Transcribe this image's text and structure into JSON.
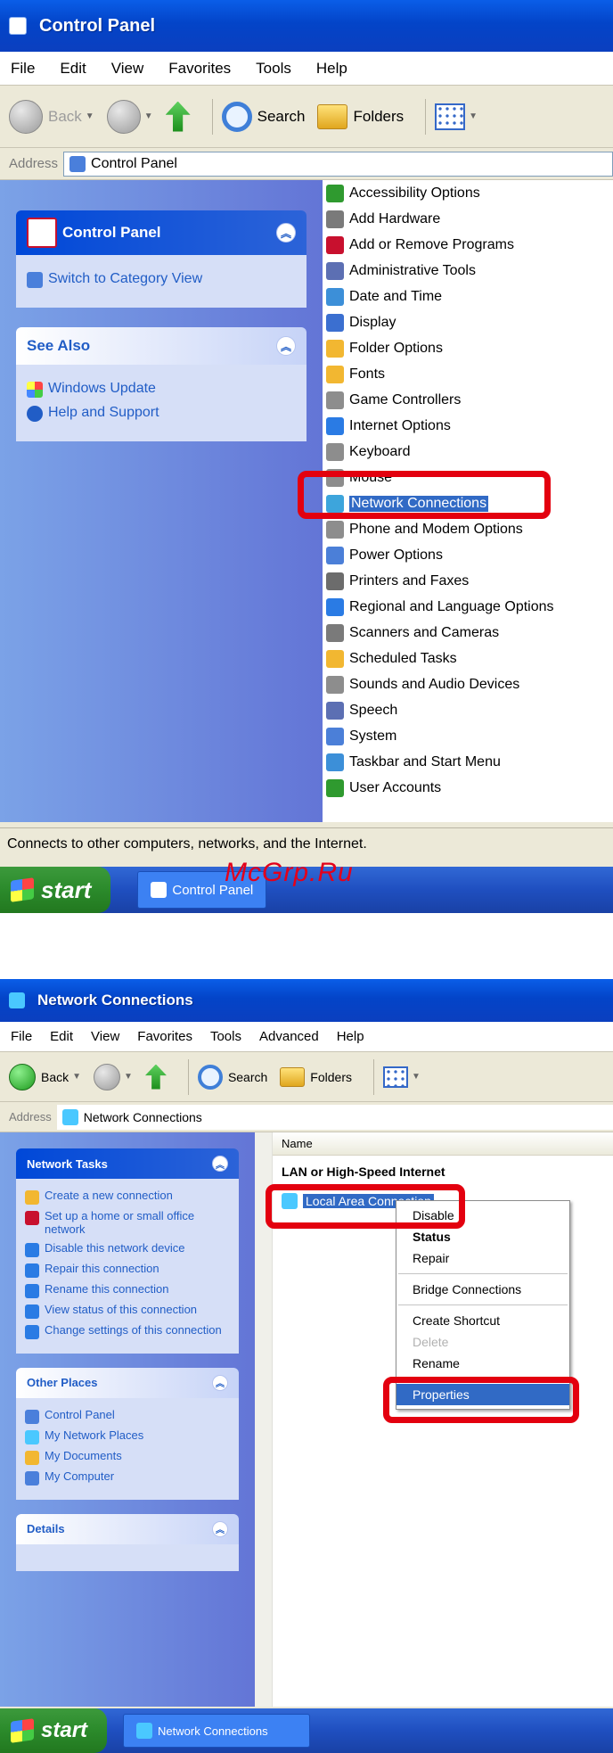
{
  "colors": {
    "highlight_box": "#e3000f",
    "xp_blue": "#0344c8",
    "selection": "#316ac5",
    "watermark": "#e3001b"
  },
  "screen1": {
    "title": "Control Panel",
    "menu": [
      "File",
      "Edit",
      "View",
      "Favorites",
      "Tools",
      "Help"
    ],
    "toolbar": {
      "back": "Back",
      "search": "Search",
      "folders": "Folders"
    },
    "address_label": "Address",
    "address_value": "Control Panel",
    "taskpane": {
      "control_panel_title": "Control Panel",
      "switch_link": "Switch to Category View",
      "see_also_title": "See Also",
      "see_also_links": [
        "Windows Update",
        "Help and Support"
      ]
    },
    "items": [
      "Accessibility Options",
      "Add Hardware",
      "Add or Remove Programs",
      "Administrative Tools",
      "Date and Time",
      "Display",
      "Folder Options",
      "Fonts",
      "Game Controllers",
      "Internet Options",
      "Keyboard",
      "Mouse",
      "Network Connections",
      "Phone and Modem Options",
      "Power Options",
      "Printers and Faxes",
      "Regional and Language Options",
      "Scanners and Cameras",
      "Scheduled Tasks",
      "Sounds and Audio Devices",
      "Speech",
      "System",
      "Taskbar and Start Menu",
      "User Accounts"
    ],
    "status": "Connects to other computers, networks, and the Internet.",
    "taskbar": {
      "start": "start",
      "task": "Control Panel"
    },
    "watermark": "McGrp.Ru"
  },
  "screen2": {
    "title": "Network Connections",
    "menu": [
      "File",
      "Edit",
      "View",
      "Favorites",
      "Tools",
      "Advanced",
      "Help"
    ],
    "toolbar": {
      "back": "Back",
      "search": "Search",
      "folders": "Folders"
    },
    "address_label": "Address",
    "address_value": "Network Connections",
    "taskpane": {
      "network_tasks_title": "Network Tasks",
      "network_tasks": [
        "Create a new connection",
        "Set up a home or small office network",
        "Disable this network device",
        "Repair this connection",
        "Rename this connection",
        "View status of this connection",
        "Change settings of this connection"
      ],
      "other_places_title": "Other Places",
      "other_places": [
        "Control Panel",
        "My Network Places",
        "My Documents",
        "My Computer"
      ],
      "details_title": "Details"
    },
    "column_name": "Name",
    "group_title": "LAN or High-Speed Internet",
    "connection": "Local Area Connection",
    "context_menu": [
      "Disable",
      "Status",
      "Repair",
      "Bridge Connections",
      "Create Shortcut",
      "Delete",
      "Rename",
      "Properties"
    ],
    "taskbar": {
      "start": "start",
      "task": "Network Connections"
    }
  }
}
